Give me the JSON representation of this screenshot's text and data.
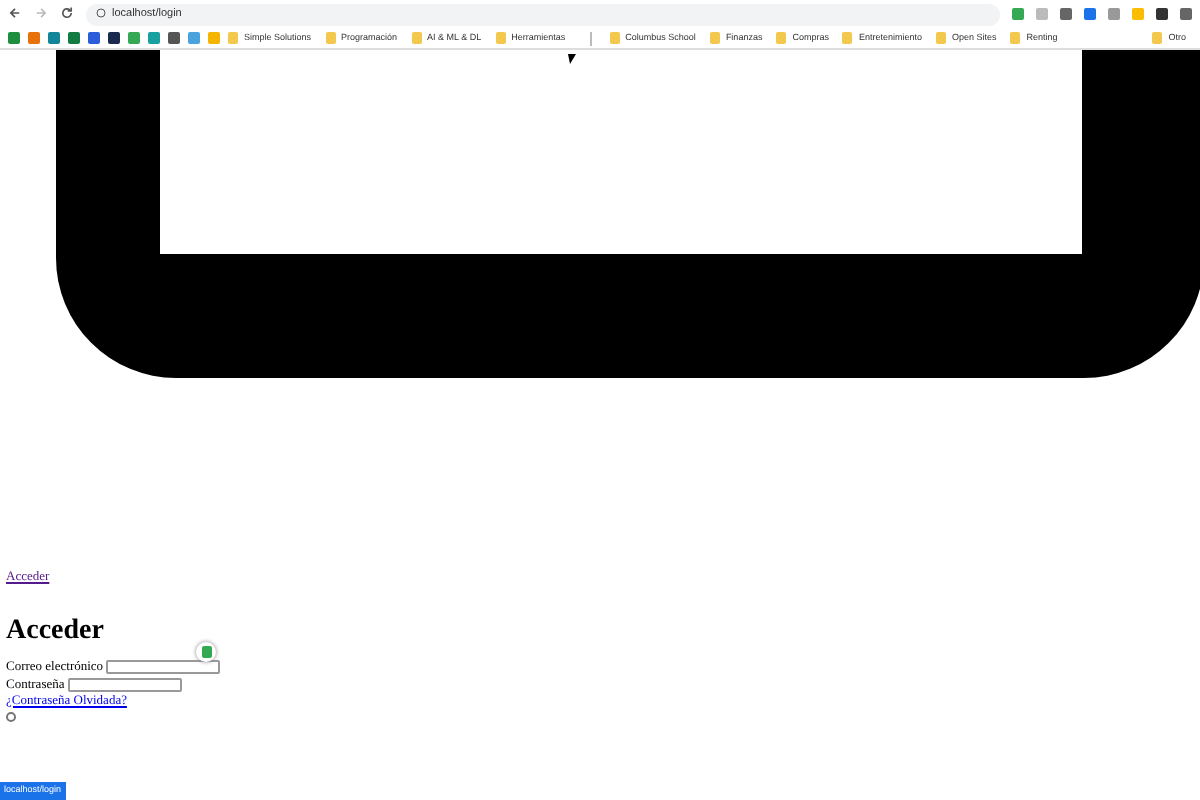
{
  "browser": {
    "address": "localhost/login",
    "bookmarks": [
      {
        "kind": "site",
        "color": "#1e8e3e"
      },
      {
        "kind": "site",
        "color": "#e8710a"
      },
      {
        "kind": "site",
        "color": "#12859a"
      },
      {
        "kind": "site",
        "color": "#107c41"
      },
      {
        "kind": "site",
        "color": "#2b5cd9"
      },
      {
        "kind": "site",
        "color": "#1a2a4f"
      },
      {
        "kind": "site",
        "color": "#34a853"
      },
      {
        "kind": "site",
        "color": "#19a0a0"
      },
      {
        "kind": "site",
        "color": "#555555"
      },
      {
        "kind": "site",
        "color": "#4aa3df"
      },
      {
        "kind": "site",
        "color": "#f4b400"
      },
      {
        "kind": "folder",
        "label": "Simple Solutions"
      },
      {
        "kind": "folder",
        "label": "Programación"
      },
      {
        "kind": "folder",
        "label": "AI & ML & DL"
      },
      {
        "kind": "folder",
        "label": "Herramientas"
      },
      {
        "kind": "separator"
      },
      {
        "kind": "folder",
        "label": "Columbus School"
      },
      {
        "kind": "folder",
        "label": "Finanzas"
      },
      {
        "kind": "folder",
        "label": "Compras"
      },
      {
        "kind": "folder",
        "label": "Entretenimiento"
      },
      {
        "kind": "folder",
        "label": "Open Sites"
      },
      {
        "kind": "folder",
        "label": "Renting"
      }
    ],
    "other_bookmarks": "Otro",
    "status_bar": "localhost/login"
  },
  "page": {
    "link": "Acceder",
    "heading": "Acceder",
    "fields": [
      {
        "label": "Correo electrónico"
      },
      {
        "label": "Contraseña"
      }
    ],
    "forgot_link": "¿Contraseña Olvidada?",
    "remember": {
      "checked": false
    }
  }
}
